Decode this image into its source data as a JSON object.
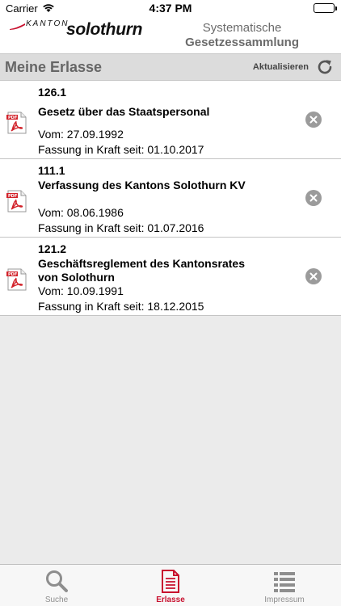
{
  "status_bar": {
    "carrier": "Carrier",
    "time": "4:37 PM",
    "battery_level": 1.0
  },
  "header": {
    "logo_prefix": "KANTON",
    "logo_name": "solothurn",
    "subtitle_line1": "Systematische",
    "subtitle_line2": "Gesetzessammlung",
    "brand_color": "#c8102e"
  },
  "section": {
    "title": "Meine Erlasse",
    "refresh_label": "Aktualisieren",
    "refresh_icon": "refresh-icon"
  },
  "items": [
    {
      "number": "126.1",
      "title": "Gesetz über das Staatspersonal",
      "vom": "Vom: 27.09.1992",
      "fassung": "Fassung in Kraft seit: 01.10.2017",
      "icon": "pdf-icon"
    },
    {
      "number": "111.1",
      "title": "Verfassung des Kantons Solothurn KV",
      "vom": "Vom: 08.06.1986",
      "fassung": "Fassung in Kraft seit: 01.07.2016",
      "icon": "pdf-icon"
    },
    {
      "number": "121.2",
      "title": "Geschäftsreglement des Kantonsrates von Solothurn",
      "vom": "Vom: 10.09.1991",
      "fassung": "Fassung in Kraft seit: 18.12.2015",
      "icon": "pdf-icon"
    }
  ],
  "tabs": [
    {
      "label": "Suche",
      "icon": "search-icon",
      "active": false
    },
    {
      "label": "Erlasse",
      "icon": "document-icon",
      "active": true
    },
    {
      "label": "Impressum",
      "icon": "list-icon",
      "active": false
    }
  ],
  "colors": {
    "accent": "#c8102e",
    "inactive": "#8e8e8e",
    "background": "#ebebeb"
  }
}
